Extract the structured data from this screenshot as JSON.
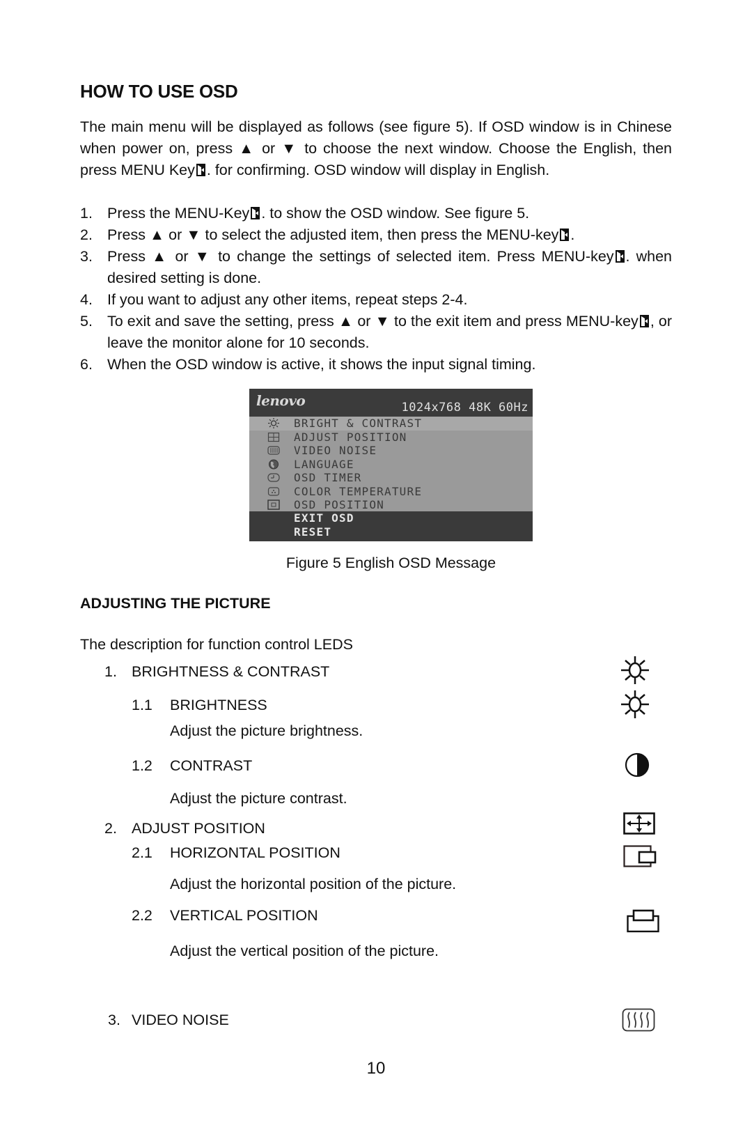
{
  "heading": "HOW TO USE OSD",
  "intro": {
    "part1": "The main menu will be displayed as follows (see figure 5). If OSD window is in Chinese when power on, press ▲ or ▼ to choose the next window. Choose the English, then press MENU Key",
    "part2": ". for confirming. OSD window will display in English."
  },
  "steps": [
    {
      "num": "1.",
      "before": "Press the MENU-Key",
      "after": ". to show the OSD window. See figure 5.",
      "has_key": true
    },
    {
      "num": "2.",
      "before": "Press ▲ or ▼ to select the adjusted item, then press the MENU-key",
      "after": ".",
      "has_key": true
    },
    {
      "num": "3.",
      "before": "Press ▲ or ▼ to change the settings of selected item. Press MENU-key",
      "after": ". when desired setting is done.",
      "has_key": true
    },
    {
      "num": "4.",
      "before": "If you want to adjust any other items, repeat steps 2-4.",
      "after": "",
      "has_key": false
    },
    {
      "num": "5.",
      "before": "To exit and save the setting, press ▲ or ▼ to the exit item and press MENU-key",
      "after": ", or leave the monitor alone for 10 seconds.",
      "has_key": true
    },
    {
      "num": "6.",
      "before": "When the OSD window is active, it shows the input signal timing.",
      "after": "",
      "has_key": false
    }
  ],
  "osd": {
    "logo": "lenovo",
    "timing": "1024x768 48K 60Hz",
    "items": [
      {
        "icon": "sun-icon",
        "label": "BRIGHT & CONTRAST",
        "selected": true
      },
      {
        "icon": "position-grid-icon",
        "label": "ADJUST POSITION",
        "selected": false
      },
      {
        "icon": "video-noise-icon",
        "label": "VIDEO NOISE",
        "selected": false
      },
      {
        "icon": "globe-icon",
        "label": "LANGUAGE",
        "selected": false
      },
      {
        "icon": "timer-icon",
        "label": "OSD TIMER",
        "selected": false
      },
      {
        "icon": "color-temperature-icon",
        "label": "COLOR TEMPERATURE",
        "selected": false
      },
      {
        "icon": "osd-position-icon",
        "label": "OSD POSITION",
        "selected": false
      }
    ],
    "footer_items": [
      "EXIT OSD",
      "RESET"
    ]
  },
  "figure_caption": "Figure 5 English OSD Message",
  "section2": {
    "heading": "ADJUSTING THE PICTURE",
    "intro": "The description for function control LEDS",
    "items": [
      {
        "num": "1.",
        "label": "BRIGHTNESS & CONTRAST",
        "icon": "sun-icon"
      },
      {
        "num": "1.1",
        "label": "BRIGHTNESS",
        "desc": "Adjust the picture brightness.",
        "icon": "sun-icon"
      },
      {
        "num": "1.2",
        "label": "CONTRAST",
        "desc": "Adjust the picture contrast.",
        "icon": "contrast-icon"
      },
      {
        "num": "2.",
        "label": "ADJUST POSITION",
        "icon": "move-arrows-icon"
      },
      {
        "num": "2.1",
        "label": "HORIZONTAL POSITION",
        "desc": "Adjust the horizontal position of the picture.",
        "icon": "horizontal-position-icon"
      },
      {
        "num": "2.2",
        "label": "VERTICAL POSITION",
        "desc": "Adjust the vertical position of the picture.",
        "icon": "vertical-position-icon"
      },
      {
        "num": "3.",
        "label": "VIDEO NOISE",
        "icon": "video-noise-icon"
      }
    ]
  },
  "page_number": "10"
}
